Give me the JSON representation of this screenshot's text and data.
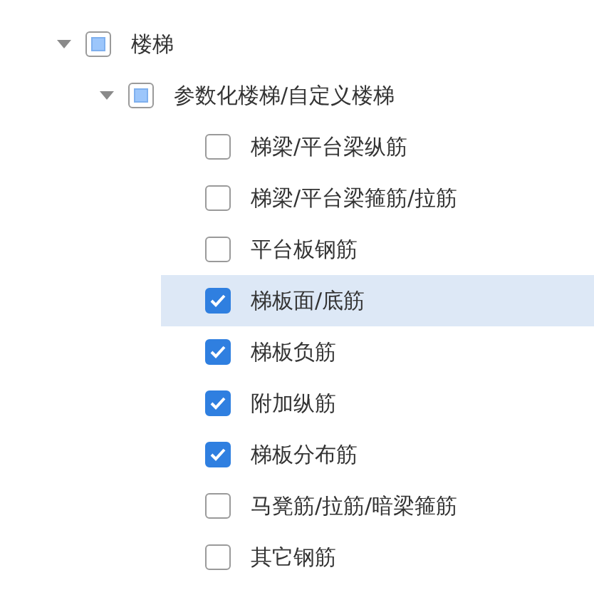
{
  "tree": [
    {
      "label": "楼梯",
      "expanded": true,
      "checked": false,
      "indeterminate": true,
      "selected": false,
      "children": [
        {
          "label": "参数化楼梯/自定义楼梯",
          "expanded": true,
          "checked": false,
          "indeterminate": true,
          "selected": false,
          "children": [
            {
              "label": "梯梁/平台梁纵筋",
              "checked": false,
              "selected": false
            },
            {
              "label": "梯梁/平台梁箍筋/拉筋",
              "checked": false,
              "selected": false
            },
            {
              "label": "平台板钢筋",
              "checked": false,
              "selected": false
            },
            {
              "label": "梯板面/底筋",
              "checked": true,
              "selected": true
            },
            {
              "label": "梯板负筋",
              "checked": true,
              "selected": false
            },
            {
              "label": "附加纵筋",
              "checked": true,
              "selected": false
            },
            {
              "label": "梯板分布筋",
              "checked": true,
              "selected": false
            },
            {
              "label": "马凳筋/拉筋/暗梁箍筋",
              "checked": false,
              "selected": false
            },
            {
              "label": "其它钢筋",
              "checked": false,
              "selected": false
            }
          ]
        }
      ]
    }
  ]
}
